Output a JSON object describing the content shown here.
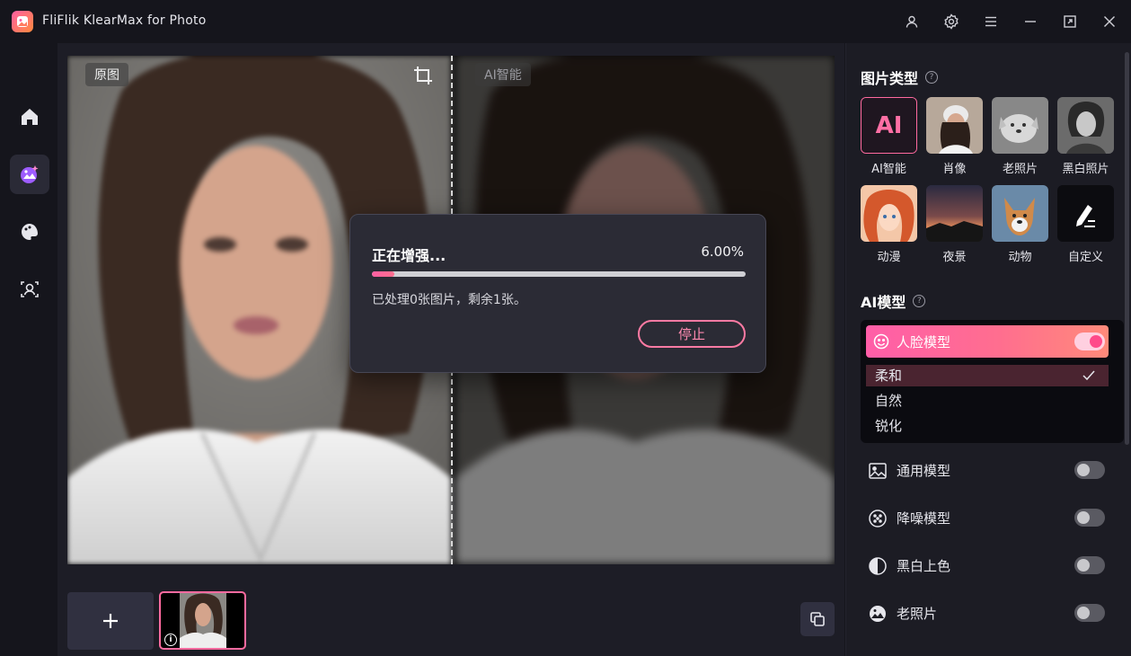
{
  "app": {
    "title": "FliFlik KlearMax for Photo"
  },
  "canvas": {
    "left_tag": "原图",
    "right_tag": "AI智能"
  },
  "progress": {
    "title": "正在增强...",
    "percent_text": "6.00%",
    "fraction": 0.06,
    "status": "已处理0张图片，剩余1张。",
    "stop_label": "停止"
  },
  "right_panel": {
    "image_type_title": "图片类型",
    "image_types": [
      {
        "label": "AI智能",
        "icon": "ai-icon",
        "selected": true
      },
      {
        "label": "肖像",
        "icon": "portrait-thumb"
      },
      {
        "label": "老照片",
        "icon": "old-photo-thumb"
      },
      {
        "label": "黑白照片",
        "icon": "bw-photo-thumb"
      },
      {
        "label": "动漫",
        "icon": "anime-thumb"
      },
      {
        "label": "夜景",
        "icon": "night-thumb"
      },
      {
        "label": "动物",
        "icon": "animal-thumb"
      },
      {
        "label": "自定义",
        "icon": "custom-icon"
      }
    ],
    "ai_model_title": "AI模型",
    "face_model": {
      "label": "人脸模型",
      "enabled": true,
      "options": [
        "柔和",
        "自然",
        "锐化"
      ],
      "selected": "柔和"
    },
    "models": [
      {
        "label": "通用模型",
        "icon": "image-icon",
        "enabled": false
      },
      {
        "label": "降噪模型",
        "icon": "denoise-icon",
        "enabled": false
      },
      {
        "label": "黑白上色",
        "icon": "colorize-icon",
        "enabled": false
      },
      {
        "label": "老照片",
        "icon": "old-photo-icon",
        "enabled": false
      }
    ]
  },
  "colors": {
    "accent": "#ff6a9f",
    "background": "#15151c",
    "panel": "#1c1c24"
  }
}
